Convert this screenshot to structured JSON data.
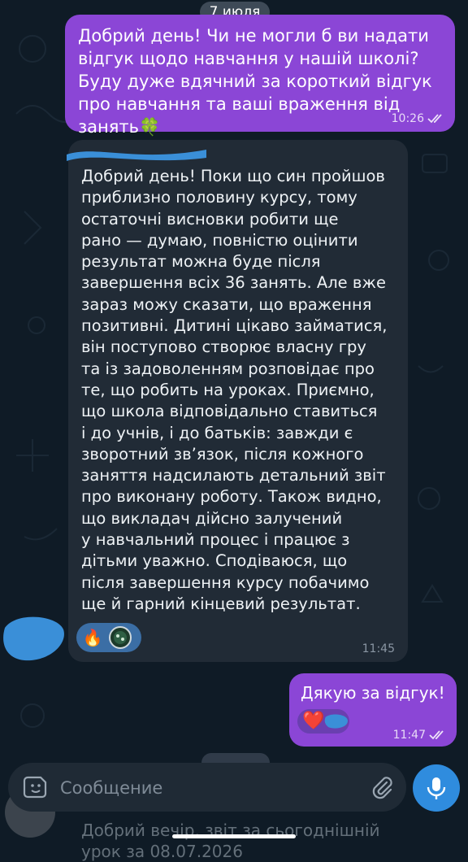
{
  "chat": {
    "date_label": "7 июля",
    "messages": [
      {
        "direction": "outgoing",
        "text": "Добрий день! Чи не могли б ви надати відгук щодо навчання у нашій школі? Буду дуже вдячний за короткий відгук про навчання та ваші враження від занять🍀",
        "time": "10:26",
        "status": "read"
      },
      {
        "direction": "incoming",
        "text": "Добрий день! Поки що син пройшов\nприблизно половину курсу, тому\nостаточні висновки робити ще\nрано — думаю, повністю оцінити\nрезультат можна буде після\nзавершення всіх 36 занять. Але вже\nзараз можу сказати, що враження\nпозитивні. Дитині цікаво займатися,\nвін поступово створює власну гру\nта із задоволенням розповідає про\nте, що робить на уроках. Приємно,\nщо школа відповідально ставиться\nі до учнів, і до батьків: завжди є\nзворотний зв’язок, після кожного\nзаняття надсилають детальний звіт\nпро виконану роботу. Також видно,\nщо викладач дійсно залучений\nу навчальний процес і працює з\nдітьми уважно. Сподіваюся, що\nпісля завершення курсу побачимо\nще й гарний кінцевий результат.",
        "time": "11:45",
        "reactions": [
          "🔥",
          "avatar"
        ]
      },
      {
        "direction": "outgoing",
        "text": "Дякую за відгук!",
        "time": "11:47",
        "status": "read",
        "reactions": [
          "❤️"
        ]
      }
    ],
    "ghost_preview": "Добрий вечір, звіт за сьогоднішній\nурок за 08.07.2026"
  },
  "composer": {
    "placeholder": "Сообщение",
    "icons": {
      "emoji": "sticker-icon",
      "attach": "paperclip-icon",
      "mic": "microphone-icon"
    }
  },
  "colors": {
    "background": "#0f1b26",
    "outgoing_bubble": "#8b46d6",
    "incoming_bubble": "#212b36",
    "reaction_pill": "#3b6ea5",
    "accent": "#2f8cde"
  }
}
